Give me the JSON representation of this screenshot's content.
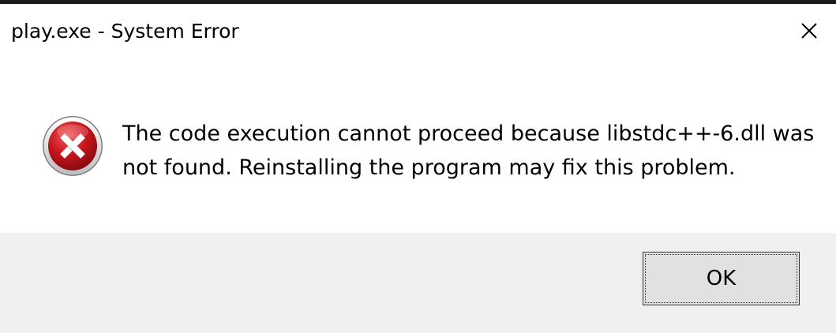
{
  "window": {
    "title": "play.exe - System Error"
  },
  "icons": {
    "close": "close-icon",
    "error": "error-icon"
  },
  "message": {
    "line1": "The code execution cannot proceed because libstdc++-6.dll was",
    "line2": "not found. Reinstalling the program may fix this problem."
  },
  "buttons": {
    "ok_label": "OK"
  },
  "colors": {
    "error_red": "#c8161d",
    "footer_bg": "#f0f0f0",
    "button_bg": "#e1e1e1"
  }
}
